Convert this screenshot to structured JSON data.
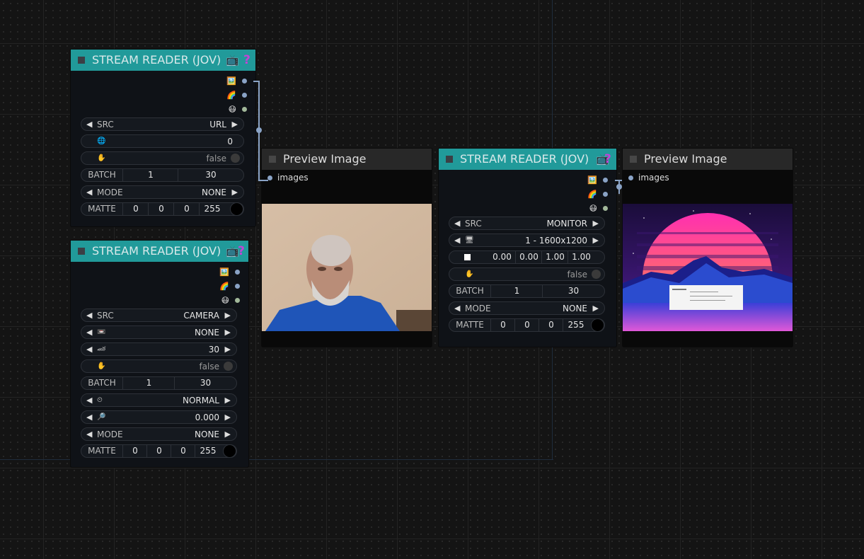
{
  "icons": {
    "tv": "📺",
    "question": "?",
    "image_out": "🖼️",
    "rainbow_out": "🌈",
    "mask_out": "😷",
    "globe": "🌐",
    "hand": "✋",
    "camera": "📼",
    "fps": "🏎",
    "timer": "⏲",
    "zoom": "🔎",
    "monitor": "🖥"
  },
  "node1": {
    "title": "STREAM READER (JOV)",
    "src_label": "SRC",
    "src_value": "URL",
    "url_value": "0",
    "hold_value": "false",
    "batch_label": "BATCH",
    "batch_a": "1",
    "batch_b": "30",
    "mode_label": "MODE",
    "mode_value": "NONE",
    "matte_label": "MATTE",
    "matte": [
      "0",
      "0",
      "0",
      "255"
    ]
  },
  "node2": {
    "title": "STREAM READER (JOV)",
    "src_label": "SRC",
    "src_value": "CAMERA",
    "camera_value": "NONE",
    "fps_value": "30",
    "hold_value": "false",
    "batch_label": "BATCH",
    "batch_a": "1",
    "batch_b": "30",
    "timer_value": "NORMAL",
    "zoom_value": "0.000",
    "mode_label": "MODE",
    "mode_value": "NONE",
    "matte_label": "MATTE",
    "matte": [
      "0",
      "0",
      "0",
      "255"
    ]
  },
  "preview1": {
    "title": "Preview Image",
    "input_label": "images"
  },
  "node3": {
    "title": "STREAM READER (JOV)",
    "src_label": "SRC",
    "src_value": "MONITOR",
    "monitor_value": "1 - 1600x1200",
    "region": [
      "0.00",
      "0.00",
      "1.00",
      "1.00"
    ],
    "hold_value": "false",
    "batch_label": "BATCH",
    "batch_a": "1",
    "batch_b": "30",
    "mode_label": "MODE",
    "mode_value": "NONE",
    "matte_label": "MATTE",
    "matte": [
      "0",
      "0",
      "0",
      "255"
    ]
  },
  "preview2": {
    "title": "Preview Image",
    "input_label": "images"
  }
}
